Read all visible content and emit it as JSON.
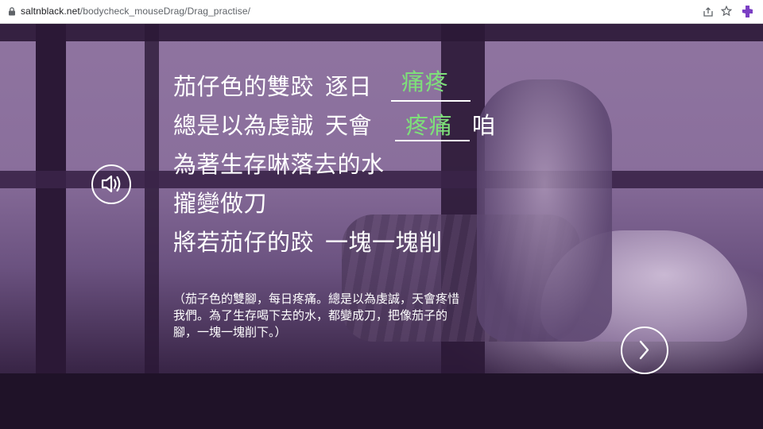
{
  "browser": {
    "url_host": "saltnblack.net",
    "url_path": "/bodycheck_mouseDrag/Drag_practise/",
    "icons": [
      "lock-icon",
      "share-icon",
      "star-icon",
      "extension-icon"
    ]
  },
  "lyrics": {
    "line1_text": "茄仔色的雙跤",
    "line1_text2": "逐日",
    "line1_answer": "痛疼",
    "line2_text": "總是以為虔誠",
    "line2_text2": "天會",
    "line2_answer": "疼痛",
    "line2_after": "咱",
    "line3": "為著生存啉落去的水",
    "line4": "攏變做刀",
    "line5_a": "將若茄仔的跤",
    "line5_b": "一塊一塊削"
  },
  "translation": "（茄子色的雙腳，每日疼痛。總是以為虔誠，天會疼惜我們。為了生存喝下去的水，都變成刀，把像茄子的腳，一塊一塊削下。）",
  "controls": {
    "audio_icon": "speaker-icon",
    "next_icon": "chevron-right-icon"
  },
  "colors": {
    "answer_green": "#7ee07a",
    "overlay_purple": "#8a6f9c",
    "text": "#ffffff"
  }
}
